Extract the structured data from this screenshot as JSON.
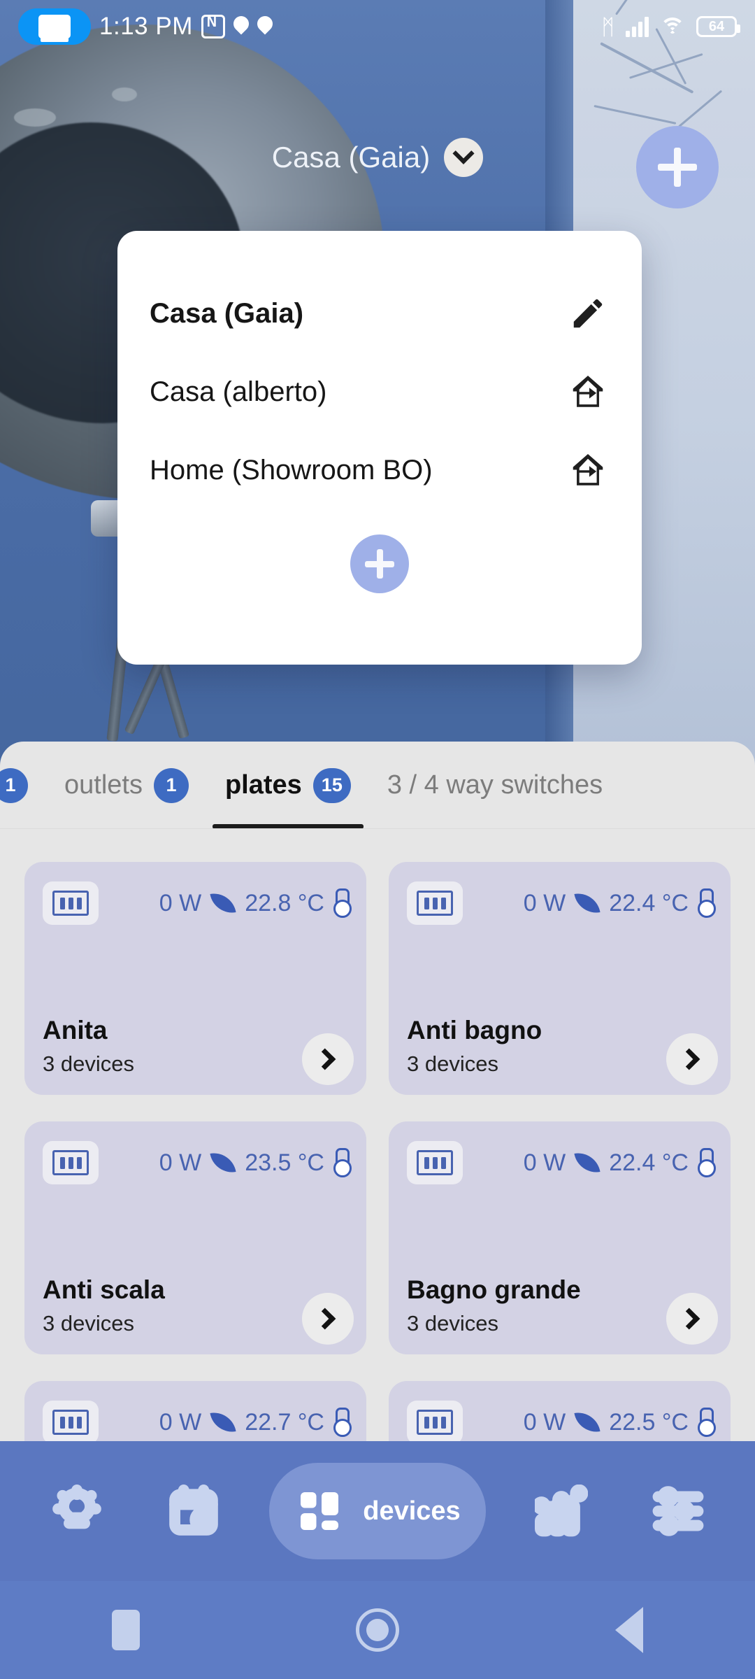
{
  "status_bar": {
    "time": "1:13 PM",
    "battery_level": "64",
    "icons": [
      "screen-cast-icon",
      "nfc-icon",
      "location-pin-icon",
      "location-pin-icon",
      "bluetooth-icon",
      "cellular-signal-icon",
      "wifi-icon",
      "battery-icon"
    ],
    "bluetooth_glyph": "ᛗ"
  },
  "header": {
    "home_name": "Casa (Gaia)",
    "chevron_icon": "chevron-down-icon",
    "add_icon": "plus-icon"
  },
  "homes_dialog": {
    "rows": [
      {
        "label": "Casa (Gaia)",
        "icon": "pencil-edit-icon",
        "active": true
      },
      {
        "label": "Casa (alberto)",
        "icon": "enter-house-icon",
        "active": false
      },
      {
        "label": "Home (Showroom BO)",
        "icon": "enter-house-icon",
        "active": false
      }
    ],
    "add_icon": "plus-icon"
  },
  "tabs": [
    {
      "label": "",
      "badge": "1",
      "active": false,
      "clipped": true
    },
    {
      "label": "outlets",
      "badge": "1",
      "active": false,
      "clipped": false
    },
    {
      "label": "plates",
      "badge": "15",
      "active": true,
      "clipped": false
    },
    {
      "label": "3 / 4 way switches",
      "badge": "",
      "active": false,
      "clipped": false
    }
  ],
  "cards": [
    {
      "power": "0 W",
      "temp": "22.8 °C",
      "title": "Anita",
      "subtitle": "3 devices"
    },
    {
      "power": "0 W",
      "temp": "22.4 °C",
      "title": "Anti bagno",
      "subtitle": "3 devices"
    },
    {
      "power": "0 W",
      "temp": "23.5 °C",
      "title": "Anti scala",
      "subtitle": "3 devices"
    },
    {
      "power": "0 W",
      "temp": "22.4 °C",
      "title": "Bagno grande",
      "subtitle": "3 devices"
    },
    {
      "power": "0 W",
      "temp": "22.7 °C",
      "title": "",
      "subtitle": ""
    },
    {
      "power": "0 W",
      "temp": "22.5 °C",
      "title": "",
      "subtitle": ""
    }
  ],
  "bottom_nav": {
    "items": [
      {
        "icon": "scenes-light-icon",
        "label": "",
        "active": false
      },
      {
        "icon": "schedule-calendar-clock-icon",
        "label": "",
        "active": false
      },
      {
        "icon": "devices-grid-icon",
        "label": "devices",
        "active": true
      },
      {
        "icon": "statistics-chart-icon",
        "label": "",
        "active": false
      },
      {
        "icon": "settings-sliders-icon",
        "label": "",
        "active": false
      }
    ]
  },
  "android_nav": {
    "recents_icon": "recents-square-icon",
    "home_icon": "home-circle-icon",
    "back_icon": "back-triangle-icon"
  },
  "colors": {
    "accent_blue": "#3e6bc2",
    "nav_blue": "#5b77c0",
    "card_lavender": "#d3d2e4",
    "fab_periwinkle": "#9fb0e8",
    "metric_blue": "#4863b0"
  }
}
